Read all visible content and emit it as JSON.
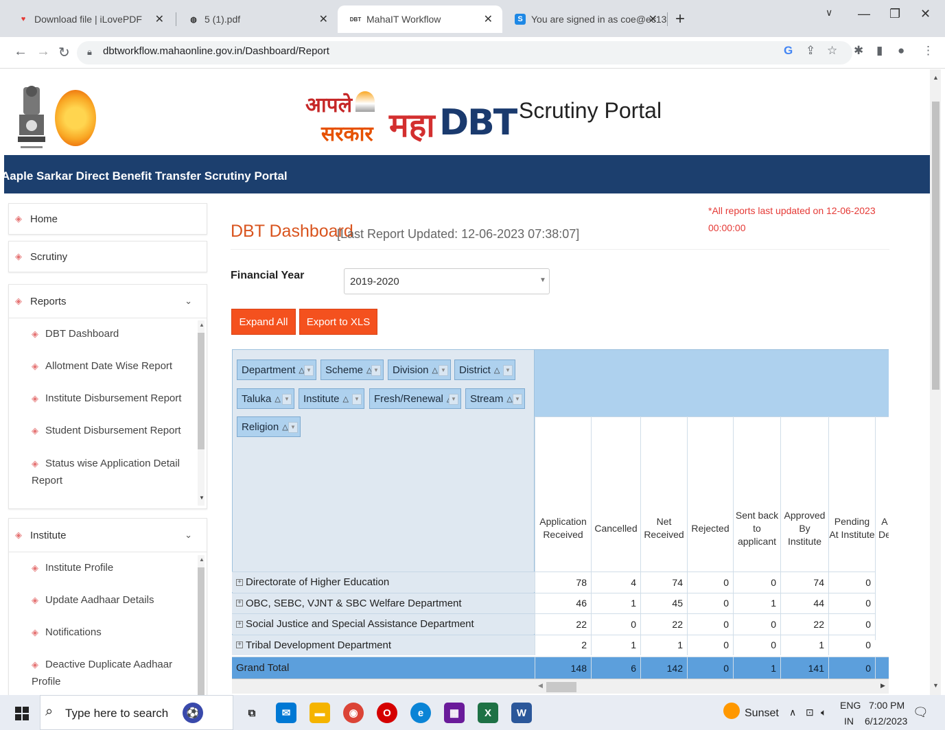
{
  "browser": {
    "tabs": [
      {
        "title": "Download file | iLovePDF",
        "active": false
      },
      {
        "title": "5 (1).pdf",
        "active": false
      },
      {
        "title": "MahaIT Workflow",
        "active": true
      },
      {
        "title": "You are signed in as coe@ec13",
        "active": false
      }
    ],
    "url": "dbtworkflow.mahaonline.gov.in/Dashboard/Report"
  },
  "header": {
    "logo_aaple": "आपले",
    "logo_sarkar": "सरकार",
    "logo_maha": "महा",
    "logo_dbt": "DBT",
    "portal_title": "Scrutiny Portal",
    "banner": "Aaple Sarkar Direct Benefit Transfer Scrutiny Portal"
  },
  "sidebar": {
    "home": "Home",
    "scrutiny": "Scrutiny",
    "reports": {
      "label": "Reports",
      "items": [
        "DBT Dashboard",
        "Allotment Date Wise Report",
        "Institute Disbursement Report",
        "Student Disbursement Report",
        "Status wise Application Detail Report"
      ]
    },
    "institute": {
      "label": "Institute",
      "items": [
        "Institute Profile",
        "Update Aadhaar Details",
        "Notifications",
        "Deactive Duplicate Aadhaar Profile"
      ]
    }
  },
  "main": {
    "update_note": "*All reports last updated on 12-06-2023 00:00:00",
    "title": "DBT Dashboard",
    "subtitle": "[Last Report Updated: 12-06-2023 07:38:07]",
    "fy_label": "Financial Year",
    "fy_value": "2019-2020",
    "expand_all": "Expand All",
    "export_xls": "Export to XLS"
  },
  "pivot": {
    "row_fields": [
      "Department",
      "Scheme",
      "Division",
      "District",
      "Taluka",
      "Institute",
      "Fresh/Renewal",
      "Stream",
      "Religion"
    ],
    "columns": [
      "Application Received",
      "Cancelled",
      "Net Received",
      "Rejected",
      "Sent back to applicant",
      "Approved By Institute",
      "Pending At Institute",
      "A De"
    ],
    "rows": [
      {
        "label": "Directorate of Higher Education",
        "values": [
          "78",
          "4",
          "74",
          "0",
          "0",
          "74",
          "0"
        ]
      },
      {
        "label": "OBC, SEBC, VJNT & SBC Welfare Department",
        "values": [
          "46",
          "1",
          "45",
          "0",
          "1",
          "44",
          "0"
        ]
      },
      {
        "label": "Social Justice and Special Assistance Department",
        "values": [
          "22",
          "0",
          "22",
          "0",
          "0",
          "22",
          "0"
        ]
      },
      {
        "label": "Tribal Development Department",
        "values": [
          "2",
          "1",
          "1",
          "0",
          "0",
          "1",
          "0"
        ]
      }
    ],
    "grand_total": {
      "label": "Grand Total",
      "values": [
        "148",
        "6",
        "142",
        "0",
        "1",
        "141",
        "0"
      ]
    }
  },
  "taskbar": {
    "search_placeholder": "Type here to search",
    "weather": "Sunset",
    "lang": "ENG",
    "region": "IN",
    "time": "7:00 PM",
    "date": "6/12/2023"
  }
}
